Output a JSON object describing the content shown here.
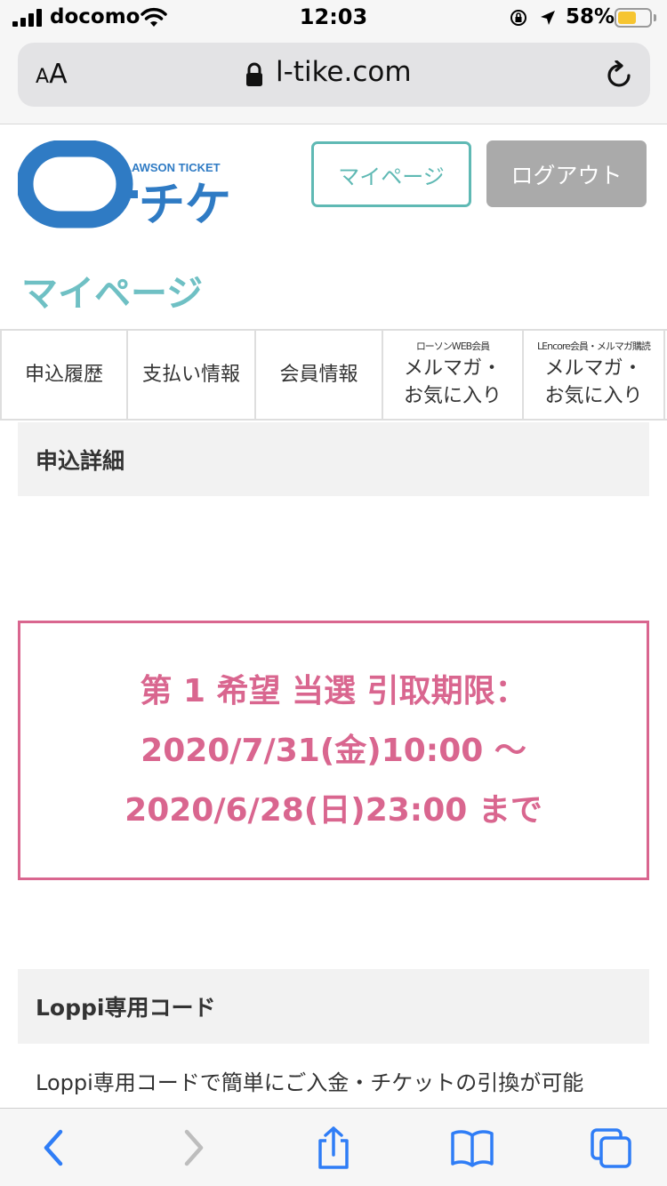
{
  "status_bar": {
    "carrier": "docomo",
    "time": "12:03",
    "battery_percent": "58%",
    "battery_level": 0.58,
    "battery_color": "#f6c531"
  },
  "browser": {
    "text_size_label_small": "A",
    "text_size_label_large": "A",
    "url": "l-tike.com",
    "icons": [
      "lock-icon",
      "reload-icon",
      "back-icon",
      "forward-icon",
      "share-icon",
      "bookmarks-icon",
      "tabs-icon"
    ]
  },
  "header": {
    "logo_brand": "LAWSON TICKET",
    "logo_text": "ローチケ",
    "mypage_button": "マイページ",
    "logout_button": "ログアウト"
  },
  "page_title": "マイページ",
  "tabs": [
    {
      "sub": "",
      "label": "申込履歴",
      "label2": ""
    },
    {
      "sub": "",
      "label": "支払い情報",
      "label2": ""
    },
    {
      "sub": "",
      "label": "会員情報",
      "label2": ""
    },
    {
      "sub": "ローソンWEB会員",
      "label": "メルマガ・",
      "label2": "お気に入り"
    },
    {
      "sub": "LEncore会員・メルマガ購読",
      "label": "メルマガ・",
      "label2": "お気に入り"
    }
  ],
  "detail_section": {
    "title": "申込詳細"
  },
  "notice": {
    "line1": "第 1 希望 当選 引取期限：",
    "line2": "2020/7/31(金)10:00 ～",
    "line3": "2020/6/28(日)23:00 まで"
  },
  "loppi_section": {
    "title": "Loppi専用コード",
    "description": "Loppi専用コードで簡単にご入金・チケットの引換が可能"
  },
  "colors": {
    "accent_teal": "#5fb9b4",
    "title_teal": "#6fc0c4",
    "notice_pink": "#d9668f",
    "logo_blue": "#2f7bc4",
    "toolbar_blue": "#2f7df6"
  }
}
